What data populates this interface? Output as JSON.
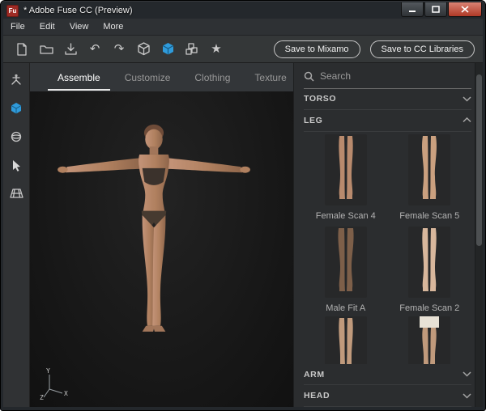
{
  "window": {
    "title": "* Adobe Fuse CC (Preview)",
    "app_icon": "Fu"
  },
  "menubar": {
    "items": [
      {
        "label": "File"
      },
      {
        "label": "Edit"
      },
      {
        "label": "View"
      },
      {
        "label": "More"
      }
    ]
  },
  "toolbar": {
    "icons": [
      {
        "name": "new-document-icon"
      },
      {
        "name": "open-folder-icon"
      },
      {
        "name": "save-icon"
      },
      {
        "name": "undo-icon",
        "glyph": "↶"
      },
      {
        "name": "redo-icon",
        "glyph": "↷"
      },
      {
        "name": "cube-outline-icon"
      },
      {
        "name": "cube-solid-icon",
        "active": true
      },
      {
        "name": "group-cubes-icon"
      },
      {
        "name": "favorite-star-icon",
        "glyph": "★"
      }
    ],
    "save_to_mixamo": "Save to Mixamo",
    "save_to_cc": "Save to CC Libraries"
  },
  "tabs": [
    {
      "label": "Assemble",
      "active": true
    },
    {
      "label": "Customize",
      "active": false
    },
    {
      "label": "Clothing",
      "active": false
    },
    {
      "label": "Texture",
      "active": false
    }
  ],
  "viewport": {
    "axis": {
      "x": "X",
      "y": "Y",
      "z": "Z"
    }
  },
  "panel": {
    "search_placeholder": "Search",
    "sections": [
      {
        "label": "TORSO",
        "expanded": false
      },
      {
        "label": "LEG",
        "expanded": true
      },
      {
        "label": "ARM",
        "expanded": false
      },
      {
        "label": "HEAD",
        "expanded": false
      }
    ],
    "leg_items": [
      {
        "label": "Female Scan 4"
      },
      {
        "label": "Female Scan 5"
      },
      {
        "label": "Male Fit A"
      },
      {
        "label": "Female Scan 2"
      }
    ]
  },
  "colors": {
    "accent_blue": "#2f9bdb",
    "close_red": "#b03a27",
    "skin": "#b9876a"
  }
}
